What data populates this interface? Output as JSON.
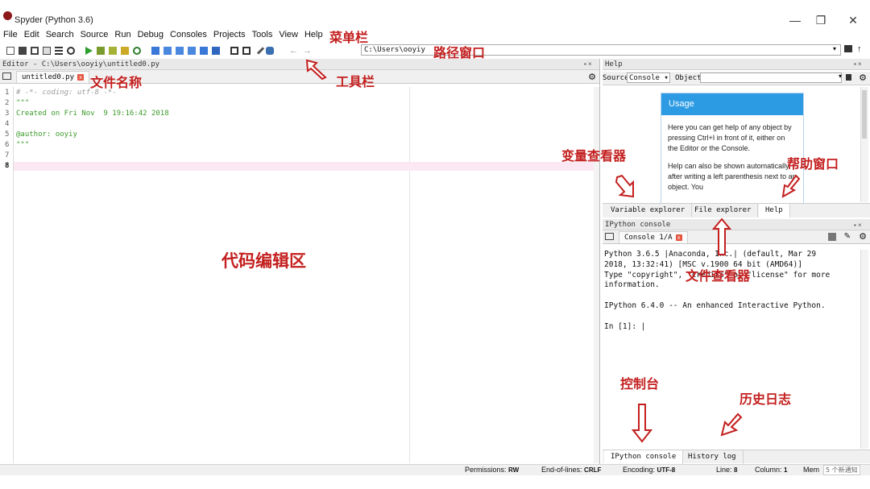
{
  "window": {
    "title": "Spyder (Python 3.6)",
    "controls": [
      "—",
      "❐",
      "✕"
    ]
  },
  "menu": [
    "File",
    "Edit",
    "Search",
    "Source",
    "Run",
    "Debug",
    "Consoles",
    "Projects",
    "Tools",
    "View",
    "Help"
  ],
  "toolbar": {
    "path_value": "C:\\Users\\ooyiy"
  },
  "editor": {
    "title": "Editor - C:\\Users\\ooyiy\\untitled0.py",
    "tab_label": "untitled0.py",
    "line_numbers": [
      "1",
      "2",
      "3",
      "4",
      "5",
      "6",
      "7",
      "8"
    ],
    "lines": [
      "# -*- coding: utf-8 -*-",
      "\"\"\"",
      "Created on Fri Nov  9 19:16:42 2018",
      "",
      "@author: ooyiy",
      "\"\"\"",
      "",
      ""
    ]
  },
  "help": {
    "title": "Help",
    "source_label": "Source",
    "source_value": "Console",
    "object_label": "Object",
    "usage_title": "Usage",
    "usage_p1": "Here you can get help of any object by pressing Ctrl+I in front of it, either on the Editor or the Console.",
    "usage_p2": "Help can also be shown automatically after writing a left parenthesis next to an object. You",
    "tabs": [
      "Variable explorer",
      "File explorer",
      "Help"
    ]
  },
  "console": {
    "title": "IPython console",
    "tab_label": "Console 1/A",
    "text": "Python 3.6.5 |Anaconda, Inc.| (default, Mar 29\n2018, 13:32:41) [MSC v.1900 64 bit (AMD64)]\nType \"copyright\", \"credits\" or \"license\" for more\ninformation.\n\nIPython 6.4.0 -- An enhanced Interactive Python.\n\nIn [1]: |",
    "tabs": [
      "IPython console",
      "History log"
    ]
  },
  "status": {
    "permissions_label": "Permissions:",
    "permissions_value": "RW",
    "eol_label": "End-of-lines:",
    "eol_value": "CRLF",
    "encoding_label": "Encoding:",
    "encoding_value": "UTF-8",
    "line_label": "Line:",
    "line_value": "8",
    "column_label": "Column:",
    "column_value": "1",
    "memory_label": "Mem",
    "notice": "5 个新通知"
  },
  "annotations": {
    "menubar": "菜单栏",
    "path_window": "路径窗口",
    "file_name": "文件名称",
    "toolbar": "工具栏",
    "code_area": "代码编辑区",
    "variable_viewer": "变量查看器",
    "help_window": "帮助窗口",
    "file_viewer": "文件查看器",
    "console": "控制台",
    "history": "历史日志"
  },
  "colors": {
    "annotation": "#c41f1f",
    "usage_header": "#2d9be4",
    "comment": "#9a9a9a",
    "docstring": "#3a9a2a",
    "current_line": "#fbe8f3"
  }
}
